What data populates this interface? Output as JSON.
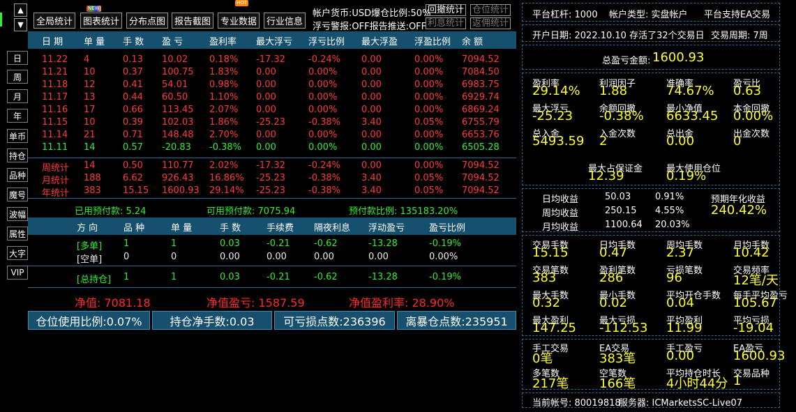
{
  "nav": {
    "up": "▲",
    "down": "▼"
  },
  "sidebar": [
    "日",
    "周",
    "月",
    "年",
    "单币",
    "持仓",
    "品种",
    "魔号",
    "波幅",
    "属性",
    "大字",
    "VIP"
  ],
  "toolbar": {
    "buttons": [
      "全局统计",
      "图表统计",
      "分布点图",
      "报告截图",
      "专业数据",
      "行业信息"
    ],
    "badge_new": "NEW",
    "badge_hot": "HOT"
  },
  "status": {
    "line1": "帐户货币:USD爆仓比例:50%",
    "line2": "浮亏警报:OFF报告推送:OFF",
    "btn_recall": "回撤统计",
    "btn_position": "仓位统计",
    "btn_profit": "利息统计",
    "btn_rebate": "返佣统计"
  },
  "table1": {
    "headers": [
      "日 期",
      "单 量",
      "手 数",
      "盈 亏",
      "盈利率",
      "最大浮亏",
      "浮亏比例",
      "最大浮盈",
      "浮盈比例",
      "余 额"
    ],
    "rows": [
      {
        "c": [
          "11.22",
          "4",
          "0.13",
          "10.02",
          "0.18%",
          "-17.32",
          "-0.24%",
          "0.00",
          "0.00%",
          "7094.52"
        ],
        "color": "red"
      },
      {
        "c": [
          "11.21",
          "10",
          "0.37",
          "100.75",
          "1.83%",
          "0.00",
          "0.00%",
          "0.00",
          "0.00%",
          "7084.50"
        ],
        "color": "red"
      },
      {
        "c": [
          "11.18",
          "12",
          "0.41",
          "54.01",
          "0.98%",
          "0.00",
          "0.00%",
          "0.00",
          "0.00%",
          "6983.75"
        ],
        "color": "red"
      },
      {
        "c": [
          "11.17",
          "13",
          "0.44",
          "60.50",
          "1.10%",
          "0.00",
          "0.00%",
          "0.00",
          "0.00%",
          "6929.74"
        ],
        "color": "red"
      },
      {
        "c": [
          "11.16",
          "17",
          "0.66",
          "113.45",
          "2.07%",
          "0.00",
          "0.00%",
          "0.00",
          "0.00%",
          "6869.24"
        ],
        "color": "red"
      },
      {
        "c": [
          "11.15",
          "10",
          "0.39",
          "102.03",
          "1.86%",
          "-25.23",
          "-0.38%",
          "3.40",
          "0.05%",
          "6755.79"
        ],
        "color": "red"
      },
      {
        "c": [
          "11.14",
          "21",
          "0.71",
          "148.48",
          "2.70%",
          "0.00",
          "0.00%",
          "0.00",
          "0.00%",
          "6653.76"
        ],
        "color": "red"
      },
      {
        "c": [
          "11.11",
          "14",
          "0.57",
          "-20.83",
          "-0.38%",
          "0.00",
          "0.00%",
          "0.00",
          "0.00%",
          "6505.28"
        ],
        "color": "grn"
      }
    ],
    "summary": [
      {
        "c": [
          "周统计",
          "14",
          "0.50",
          "110.77",
          "2.02%",
          "-17.32",
          "-0.24%",
          "0.00",
          "0.00%",
          "7094.52"
        ]
      },
      {
        "c": [
          "月统计",
          "188",
          "6.62",
          "926.43",
          "16.86%",
          "-25.23",
          "-0.38%",
          "3.40",
          "0.05%",
          "7094.52"
        ]
      },
      {
        "c": [
          "年统计",
          "383",
          "15.15",
          "1600.93",
          "29.14%",
          "-25.23",
          "-0.38%",
          "3.40",
          "0.05%",
          "7094.52"
        ]
      }
    ]
  },
  "margin": {
    "used": "已用预付款: 5.24",
    "available": "可用预付款: 7075.94",
    "ratio": "预付款比例: 135183.20%"
  },
  "table2": {
    "headers": [
      "方 向",
      "品 种",
      "单 量",
      "手 数",
      "手续费",
      "隔夜利息",
      "浮动盈亏",
      "盈亏比例"
    ],
    "rows": [
      {
        "c": [
          "[多单]",
          "1",
          "1",
          "0.03",
          "-0.21",
          "-0.62",
          "-13.28",
          "-0.19%"
        ],
        "color": "grn"
      },
      {
        "c": [
          "[空单]",
          "0",
          "0",
          "0.00",
          "0.00",
          "0.00",
          "0.00",
          "0.00%"
        ],
        "color": "wht"
      },
      {
        "c": [
          "[总持仓]",
          "1",
          "1",
          "0.03",
          "-0.21",
          "-0.62",
          "-13.28",
          "-0.19%"
        ],
        "color": "grn"
      }
    ]
  },
  "net": {
    "value": "净值: 7081.18",
    "pnl": "净值盈亏: 1587.59",
    "rate": "净值盈利率: 28.90%"
  },
  "bottom": {
    "b1": "仓位使用比例:0.07%",
    "b2": "持仓净手数:0.03",
    "b3": "可亏损点数:236396",
    "b4": "离暴仓点数:235951"
  },
  "right": {
    "leverage": "平台杠杆: 1000",
    "acctype": "帐户类型: 实盘帐户",
    "ea": "平台支持EA交易",
    "opendate": "开户日期: 2022.10.10 存活了32个交易日",
    "period": "交易周期: 7周",
    "total_label": "总盈亏金额:",
    "total_value": "1600.93",
    "stats1": [
      [
        "盈利率",
        "29.14%"
      ],
      [
        "利润因子",
        "1.88"
      ],
      [
        "准确率",
        "74.67%"
      ],
      [
        "盈亏比",
        "0.63"
      ],
      [
        "最大浮亏",
        "-25.23"
      ],
      [
        "余额回撤",
        "-0.38%"
      ],
      [
        "最小净值",
        "6633.45"
      ],
      [
        "本金回撤",
        "0.00%"
      ],
      [
        "总入金",
        "5493.59"
      ],
      [
        "入金次数",
        "2"
      ],
      [
        "总出金",
        "0.00"
      ],
      [
        "出金次数",
        "0"
      ]
    ],
    "stats1b": [
      [
        "最大占保证金",
        "12.39"
      ],
      [
        "最大使用仓位",
        "0.19%"
      ]
    ],
    "avg": [
      [
        "日均收益",
        "50.03",
        "0.91%"
      ],
      [
        "周均收益",
        "250.15",
        "4.55%"
      ],
      [
        "月均收益",
        "1100.64",
        "20.03%"
      ]
    ],
    "annual_label": "预期年化收益",
    "annual_value": "240.42%",
    "stats2": [
      [
        "交易手数",
        "15.15"
      ],
      [
        "日均手数",
        "0.47"
      ],
      [
        "周均手数",
        "2.37"
      ],
      [
        "月均手数",
        "10.42"
      ],
      [
        "交易笔数",
        "383"
      ],
      [
        "盈利笔数",
        "286"
      ],
      [
        "亏损笔数",
        "96"
      ],
      [
        "交易频率",
        "12笔/天"
      ],
      [
        "最大手数",
        "0.32"
      ],
      [
        "最小手数",
        "0.02"
      ],
      [
        "平均开仓手数",
        "0.04"
      ],
      [
        "每手平均盈亏",
        "105.67"
      ],
      [
        "最大盈利",
        "147.25"
      ],
      [
        "最大亏损",
        "-112.53"
      ],
      [
        "平均盈利",
        "11.99"
      ],
      [
        "平均亏损",
        "-19.04"
      ]
    ],
    "stats3": [
      [
        "手工交易",
        "0笔"
      ],
      [
        "EA交易",
        "383笔"
      ],
      [
        "手工盈亏",
        "0.00"
      ],
      [
        "EA盈亏",
        "1600.93"
      ],
      [
        "多笔数",
        "217笔"
      ],
      [
        "空笔数",
        "166笔"
      ],
      [
        "平均持仓时长",
        "4小时44分"
      ],
      [
        "交易品种",
        "1"
      ]
    ],
    "account": "当前帐号: 80019818",
    "server": "服务器: ICMarketsSC-Live07"
  },
  "colors": {
    "accent": "#16506f",
    "red": "#ff3a3a",
    "green": "#33ee33",
    "yellow": "#ffff33"
  }
}
